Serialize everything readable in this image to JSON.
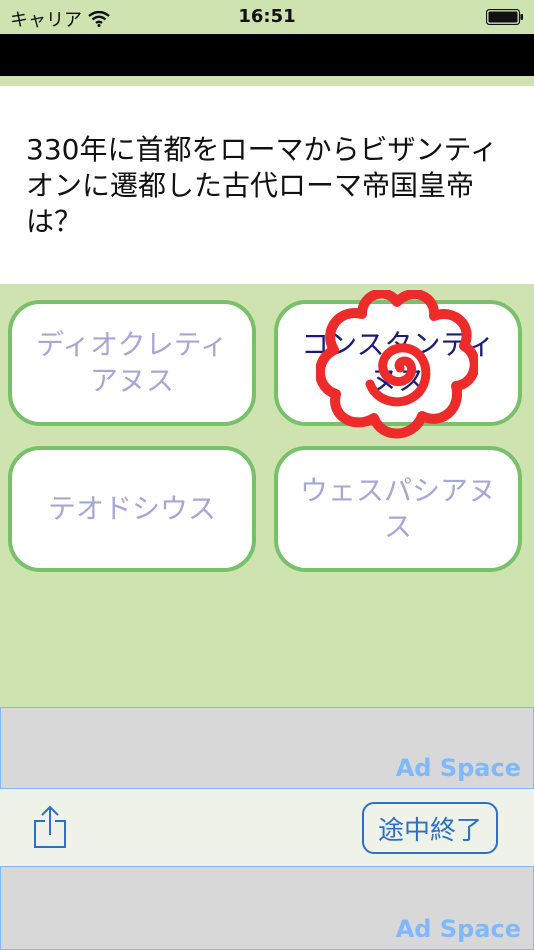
{
  "status_bar": {
    "carrier": "キャリア",
    "time": "16:51"
  },
  "question": {
    "text": "330年に首都をローマからビザンティオンに遷都した古代ローマ帝国皇帝は？"
  },
  "answers": [
    {
      "label": "ディオクレティアヌス"
    },
    {
      "label": "コンスタンティヌス"
    },
    {
      "label": "テオドシウス"
    },
    {
      "label": "ウェスパシアヌス"
    }
  ],
  "ads": {
    "top_label": "Ad Space",
    "bottom_label": "Ad Space"
  },
  "toolbar": {
    "share_icon": "share-icon",
    "quit_label": "途中終了"
  },
  "colors": {
    "background": "#cfe3b0",
    "answer_border": "#78c06a",
    "correct_mark": "#ee2b2b",
    "accent": "#2c6fc4",
    "ad_label": "#7fb8ff"
  }
}
